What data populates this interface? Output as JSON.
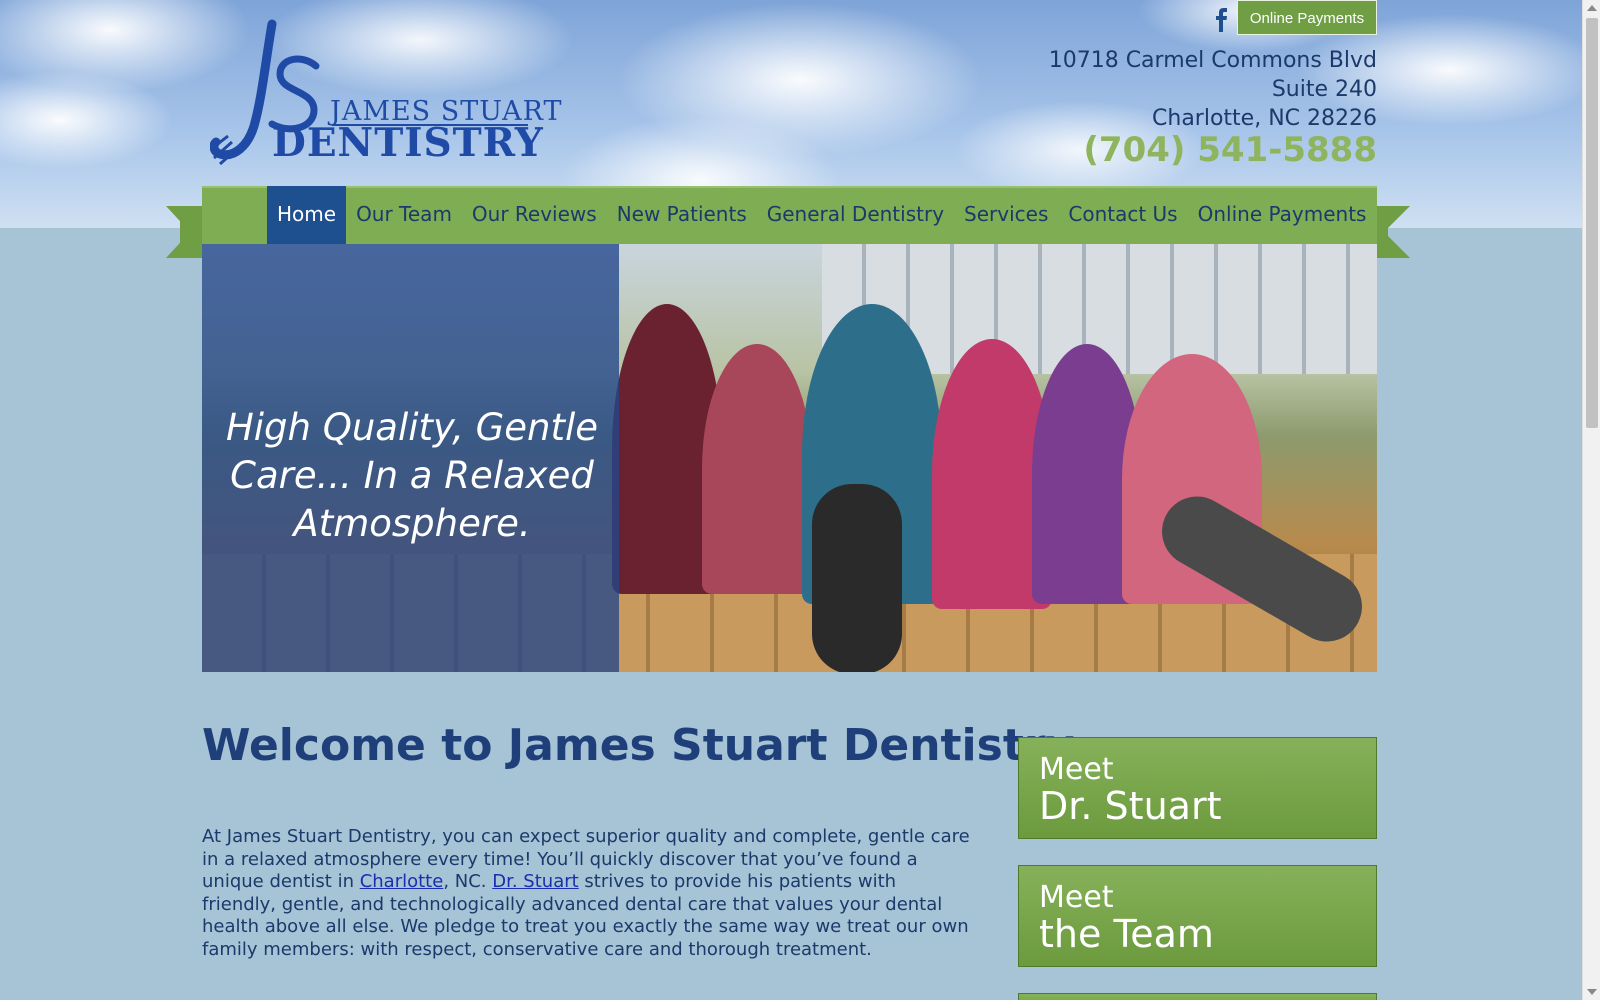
{
  "brand": {
    "name_line1": "JAMES STUART",
    "name_line2": "DENTISTRY"
  },
  "top": {
    "social_icon": "facebook-icon",
    "payments_label": "Online Payments",
    "address_line1": "10718 Carmel Commons Blvd",
    "address_line2": "Suite 240",
    "address_line3": "Charlotte, NC 28226",
    "phone": "(704) 541-5888"
  },
  "nav": {
    "items": [
      {
        "label": "Home"
      },
      {
        "label": "Our Team"
      },
      {
        "label": "Our Reviews"
      },
      {
        "label": "New Patients"
      },
      {
        "label": "General Dentistry"
      },
      {
        "label": "Services"
      },
      {
        "label": "Contact Us"
      },
      {
        "label": "Online Payments"
      }
    ]
  },
  "hero": {
    "tagline": "High Quality, Gentle Care... In a Relaxed Atmosphere."
  },
  "main": {
    "heading": "Welcome to James Stuart Dentistry",
    "p_part1": "At James Stuart Dentistry, you can expect superior quality and complete, gentle care in a relaxed atmosphere every time! You’ll quickly discover that you’ve found a unique dentist in ",
    "link_city": "Charlotte",
    "p_part2": ", NC. ",
    "link_doctor": "Dr. Stuart",
    "p_part3": " strives to provide his patients with friendly, gentle, and technologically advanced dental care that values your dental health above all else. We pledge to treat you exactly the same way we treat our own family members: with respect, conservative care and thorough treatment."
  },
  "sidebar": {
    "cta1_line1": "Meet",
    "cta1_line2": "Dr. Stuart",
    "cta2_line1": "Meet",
    "cta2_line2": "the Team"
  },
  "colors": {
    "nav_green": "#7fad53",
    "active_blue": "#1e4f8f",
    "phone_green": "#8fb45e",
    "page_bg": "#a7c3d6"
  }
}
